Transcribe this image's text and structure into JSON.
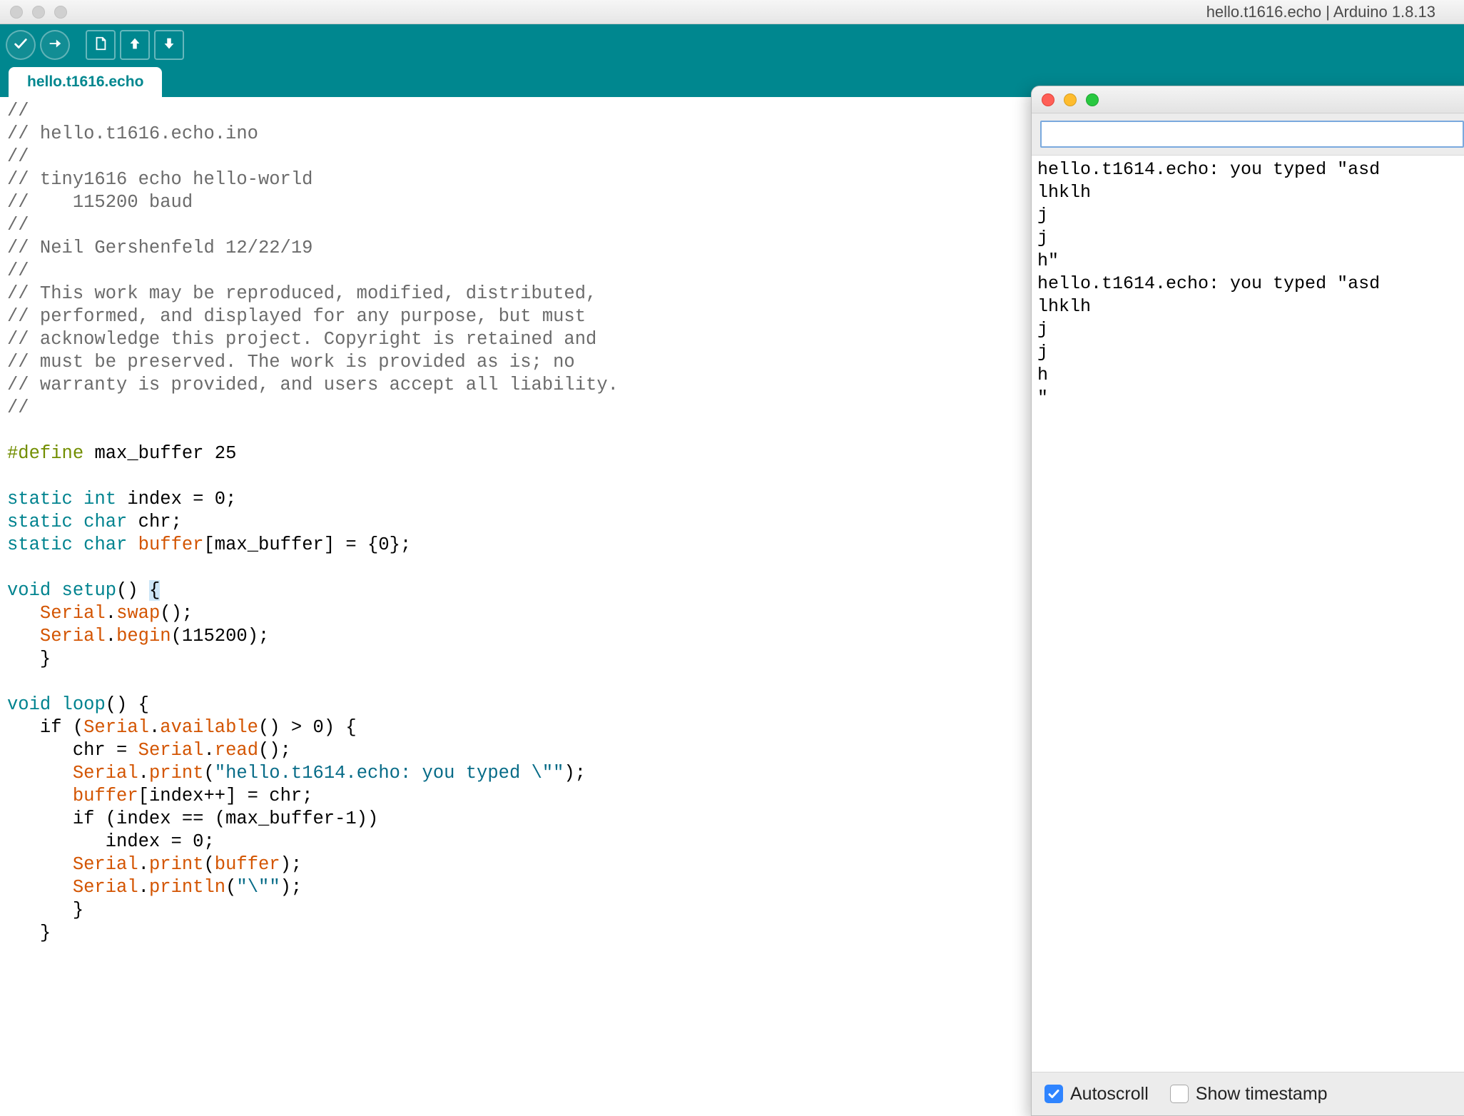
{
  "window": {
    "title": "hello.t1616.echo | Arduino 1.8.13"
  },
  "toolbar": {
    "verify_name": "verify-button",
    "upload_name": "upload-button",
    "new_name": "new-button",
    "open_name": "open-button",
    "save_name": "save-button"
  },
  "tabs": [
    {
      "label": "hello.t1616.echo"
    }
  ],
  "code": {
    "tokens": [
      {
        "t": "//",
        "c": "comment"
      },
      {
        "t": "\n"
      },
      {
        "t": "// hello.t1616.echo.ino",
        "c": "comment"
      },
      {
        "t": "\n"
      },
      {
        "t": "//",
        "c": "comment"
      },
      {
        "t": "\n"
      },
      {
        "t": "// tiny1616 echo hello-world",
        "c": "comment"
      },
      {
        "t": "\n"
      },
      {
        "t": "//    115200 baud",
        "c": "comment"
      },
      {
        "t": "\n"
      },
      {
        "t": "//",
        "c": "comment"
      },
      {
        "t": "\n"
      },
      {
        "t": "// Neil Gershenfeld 12/22/19",
        "c": "comment"
      },
      {
        "t": "\n"
      },
      {
        "t": "//",
        "c": "comment"
      },
      {
        "t": "\n"
      },
      {
        "t": "// This work may be reproduced, modified, distributed,",
        "c": "comment"
      },
      {
        "t": "\n"
      },
      {
        "t": "// performed, and displayed for any purpose, but must",
        "c": "comment"
      },
      {
        "t": "\n"
      },
      {
        "t": "// acknowledge this project. Copyright is retained and",
        "c": "comment"
      },
      {
        "t": "\n"
      },
      {
        "t": "// must be preserved. The work is provided as is; no",
        "c": "comment"
      },
      {
        "t": "\n"
      },
      {
        "t": "// warranty is provided, and users accept all liability.",
        "c": "comment"
      },
      {
        "t": "\n"
      },
      {
        "t": "//",
        "c": "comment"
      },
      {
        "t": "\n"
      },
      {
        "t": "\n"
      },
      {
        "t": "#define",
        "c": "preproc"
      },
      {
        "t": " "
      },
      {
        "t": "max_buffer 25",
        "c": "black"
      },
      {
        "t": "\n"
      },
      {
        "t": "\n"
      },
      {
        "t": "static",
        "c": "keyword"
      },
      {
        "t": " "
      },
      {
        "t": "int",
        "c": "keyword"
      },
      {
        "t": " index = 0;",
        "c": "black"
      },
      {
        "t": "\n"
      },
      {
        "t": "static",
        "c": "keyword"
      },
      {
        "t": " "
      },
      {
        "t": "char",
        "c": "keyword"
      },
      {
        "t": " chr;",
        "c": "black"
      },
      {
        "t": "\n"
      },
      {
        "t": "static",
        "c": "keyword"
      },
      {
        "t": " "
      },
      {
        "t": "char",
        "c": "keyword"
      },
      {
        "t": " "
      },
      {
        "t": "buffer",
        "c": "orange"
      },
      {
        "t": "[max_buffer] = {0};",
        "c": "black"
      },
      {
        "t": "\n"
      },
      {
        "t": "\n"
      },
      {
        "t": "void",
        "c": "keyword"
      },
      {
        "t": " "
      },
      {
        "t": "setup",
        "c": "keyword"
      },
      {
        "t": "() ",
        "c": "black"
      },
      {
        "t": "{",
        "c": "black",
        "hl": true
      },
      {
        "t": "\n"
      },
      {
        "t": "   ",
        "c": "black"
      },
      {
        "t": "Serial",
        "c": "orange"
      },
      {
        "t": ".",
        "c": "black"
      },
      {
        "t": "swap",
        "c": "orange"
      },
      {
        "t": "();",
        "c": "black"
      },
      {
        "t": "\n"
      },
      {
        "t": "   ",
        "c": "black"
      },
      {
        "t": "Serial",
        "c": "orange"
      },
      {
        "t": ".",
        "c": "black"
      },
      {
        "t": "begin",
        "c": "orange"
      },
      {
        "t": "(115200);",
        "c": "black"
      },
      {
        "t": "\n"
      },
      {
        "t": "   }",
        "c": "black"
      },
      {
        "t": "\n"
      },
      {
        "t": "\n"
      },
      {
        "t": "void",
        "c": "keyword"
      },
      {
        "t": " "
      },
      {
        "t": "loop",
        "c": "keyword"
      },
      {
        "t": "() {",
        "c": "black"
      },
      {
        "t": "\n"
      },
      {
        "t": "   if (",
        "c": "black"
      },
      {
        "t": "Serial",
        "c": "orange"
      },
      {
        "t": ".",
        "c": "black"
      },
      {
        "t": "available",
        "c": "orange"
      },
      {
        "t": "() > 0) {",
        "c": "black"
      },
      {
        "t": "\n"
      },
      {
        "t": "      chr = ",
        "c": "black"
      },
      {
        "t": "Serial",
        "c": "orange"
      },
      {
        "t": ".",
        "c": "black"
      },
      {
        "t": "read",
        "c": "orange"
      },
      {
        "t": "();",
        "c": "black"
      },
      {
        "t": "\n"
      },
      {
        "t": "      ",
        "c": "black"
      },
      {
        "t": "Serial",
        "c": "orange"
      },
      {
        "t": ".",
        "c": "black"
      },
      {
        "t": "print",
        "c": "orange"
      },
      {
        "t": "(",
        "c": "black"
      },
      {
        "t": "\"hello.t1614.echo: you typed \\\"\"",
        "c": "string"
      },
      {
        "t": ");",
        "c": "black"
      },
      {
        "t": "\n"
      },
      {
        "t": "      ",
        "c": "black"
      },
      {
        "t": "buffer",
        "c": "orange"
      },
      {
        "t": "[index++] = chr;",
        "c": "black"
      },
      {
        "t": "\n"
      },
      {
        "t": "      if (index == (max_buffer-1))",
        "c": "black"
      },
      {
        "t": "\n"
      },
      {
        "t": "         index = 0;",
        "c": "black"
      },
      {
        "t": "\n"
      },
      {
        "t": "      ",
        "c": "black"
      },
      {
        "t": "Serial",
        "c": "orange"
      },
      {
        "t": ".",
        "c": "black"
      },
      {
        "t": "print",
        "c": "orange"
      },
      {
        "t": "(",
        "c": "black"
      },
      {
        "t": "buffer",
        "c": "orange"
      },
      {
        "t": ");",
        "c": "black"
      },
      {
        "t": "\n"
      },
      {
        "t": "      ",
        "c": "black"
      },
      {
        "t": "Serial",
        "c": "orange"
      },
      {
        "t": ".",
        "c": "black"
      },
      {
        "t": "println",
        "c": "orange"
      },
      {
        "t": "(",
        "c": "black"
      },
      {
        "t": "\"\\\"\"",
        "c": "string"
      },
      {
        "t": ");",
        "c": "black"
      },
      {
        "t": "\n"
      },
      {
        "t": "      }",
        "c": "black"
      },
      {
        "t": "\n"
      },
      {
        "t": "   }",
        "c": "black"
      },
      {
        "t": "\n"
      }
    ]
  },
  "serial": {
    "input_value": "",
    "output_lines": [
      "hello.t1614.echo: you typed \"asd",
      "lhklh",
      "j",
      "j",
      "h\"",
      "hello.t1614.echo: you typed \"asd",
      "lhklh",
      "j",
      "j",
      "h",
      "\""
    ],
    "autoscroll_label": "Autoscroll",
    "timestamp_label": "Show timestamp",
    "autoscroll_checked": true,
    "timestamp_checked": false
  }
}
